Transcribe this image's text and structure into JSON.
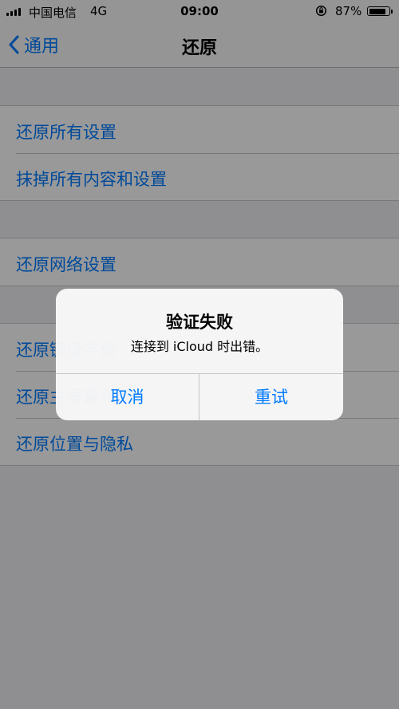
{
  "status_bar": {
    "carrier": "中国电信",
    "network": "4G",
    "time": "09:00",
    "battery_percent": "87%",
    "battery_level": 0.87,
    "icons": [
      "signal-icon",
      "rotation-lock-icon",
      "battery-icon"
    ]
  },
  "nav": {
    "back_label": "通用",
    "title": "还原"
  },
  "groups": [
    {
      "items": [
        "还原所有设置",
        "抹掉所有内容和设置"
      ]
    },
    {
      "items": [
        "还原网络设置"
      ]
    },
    {
      "items": [
        "还原键盘字典",
        "还原主屏幕布局",
        "还原位置与隐私"
      ]
    }
  ],
  "alert": {
    "title": "验证失败",
    "message": "连接到 iCloud 时出错。",
    "cancel_label": "取消",
    "retry_label": "重试"
  },
  "colors": {
    "accent": "#007aff",
    "background": "#efeff4",
    "dim_overlay": "rgba(0,0,0,0.40)"
  }
}
